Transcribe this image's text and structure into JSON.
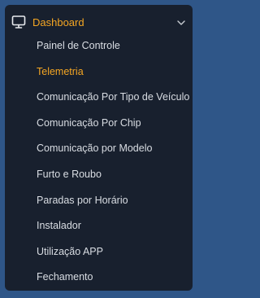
{
  "colors": {
    "background": "#2f5688",
    "panel": "#18202e",
    "accent": "#f5a623",
    "text": "#d9dde3"
  },
  "header": {
    "icon": "monitor-icon",
    "title": "Dashboard",
    "expand_icon": "chevron-down-icon"
  },
  "menu": {
    "items": [
      {
        "label": "Painel de Controle",
        "active": false
      },
      {
        "label": "Telemetria",
        "active": true
      },
      {
        "label": "Comunicação Por Tipo de Veículo",
        "active": false
      },
      {
        "label": "Comunicação Por Chip",
        "active": false
      },
      {
        "label": "Comunicação por Modelo",
        "active": false
      },
      {
        "label": "Furto e Roubo",
        "active": false
      },
      {
        "label": "Paradas por Horário",
        "active": false
      },
      {
        "label": "Instalador",
        "active": false
      },
      {
        "label": "Utilização APP",
        "active": false
      },
      {
        "label": "Fechamento",
        "active": false
      }
    ]
  }
}
